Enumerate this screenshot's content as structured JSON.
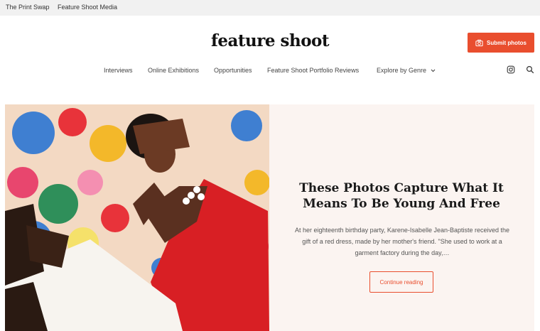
{
  "topbar": {
    "links": [
      "The Print Swap",
      "Feature Shoot Media"
    ]
  },
  "brand": {
    "logo_text": "feature shoot",
    "accent_color": "#e94e2e"
  },
  "header": {
    "submit_label": "Submit photos",
    "submit_icon": "camera-icon"
  },
  "nav": {
    "items": [
      "Interviews",
      "Online Exhibitions",
      "Opportunities",
      "Feature Shoot Portfolio Reviews",
      "Explore by Genre"
    ],
    "dropdown_icon": "chevron-down-icon",
    "social_icon": "instagram-icon",
    "search_icon": "search-icon"
  },
  "feature": {
    "headline": "These Photos Capture What It Means To Be Young And Free",
    "excerpt": "At her eighteenth birthday party, Karene-Isabelle Jean-Baptiste received the gift of a red dress, made by her mother's friend. \"She used to work at a garment factory during the day,…",
    "cta_label": "Continue reading"
  }
}
